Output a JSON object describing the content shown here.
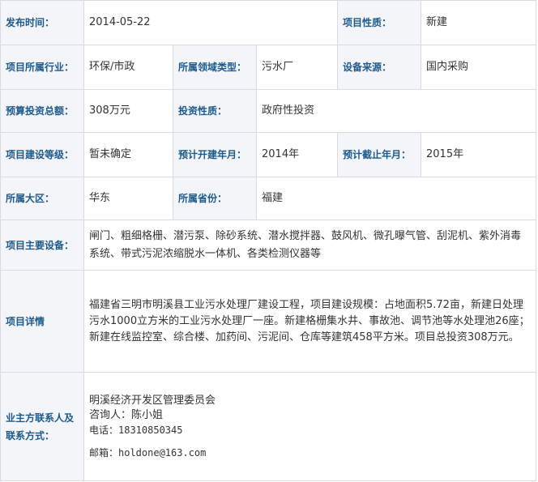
{
  "rows": {
    "publish_time": {
      "label": "发布时间：",
      "value": "2014-05-22"
    },
    "project_nature": {
      "label": "项目性质：",
      "value": "新建"
    },
    "industry": {
      "label": "项目所属行业：",
      "value": "环保/市政"
    },
    "domain_type": {
      "label": "所属领域类型：",
      "value": "污水厂"
    },
    "equipment_source": {
      "label": "设备来源：",
      "value": "国内采购"
    },
    "budget": {
      "label": "预算投资总额：",
      "value": "308万元"
    },
    "investment_nature": {
      "label": "投资性质：",
      "value": "政府性投资"
    },
    "construction_level": {
      "label": "项目建设等级：",
      "value": "暂未确定"
    },
    "planned_start": {
      "label": "预计开建年月：",
      "value": "2014年"
    },
    "planned_end": {
      "label": "预计截止年月：",
      "value": "2015年"
    },
    "region": {
      "label": "所属大区：",
      "value": "华东"
    },
    "province": {
      "label": "所属省份：",
      "value": "福建"
    },
    "main_equipment": {
      "label": "项目主要设备：",
      "value": "闸门、粗细格栅、潜污泵、除砂系统、潜水搅拌器、鼓风机、微孔曝气管、刮泥机、紫外消毒系统、带式污泥浓缩脱水一体机、各类检测仪器等"
    },
    "details": {
      "label": "项目详情",
      "value": "福建省三明市明溪县工业污水处理厂建设工程，项目建设规模：占地面积5.72亩，新建日处理污水1000立方米的工业污水处理厂一座。新建格栅集水井、事故池、调节池等水处理池26座；新建在线监控室、综合楼、加药间、污泥间、仓库等建筑458平方米。项目总投资308万元。"
    },
    "contact": {
      "label": "业主方联系人及联系方式：",
      "org": "明溪经济开发区管理委员会",
      "consultant": "咨询人：陈小姐",
      "phone": "电话：18310850345",
      "email": "邮箱：holdone@163.com"
    }
  }
}
